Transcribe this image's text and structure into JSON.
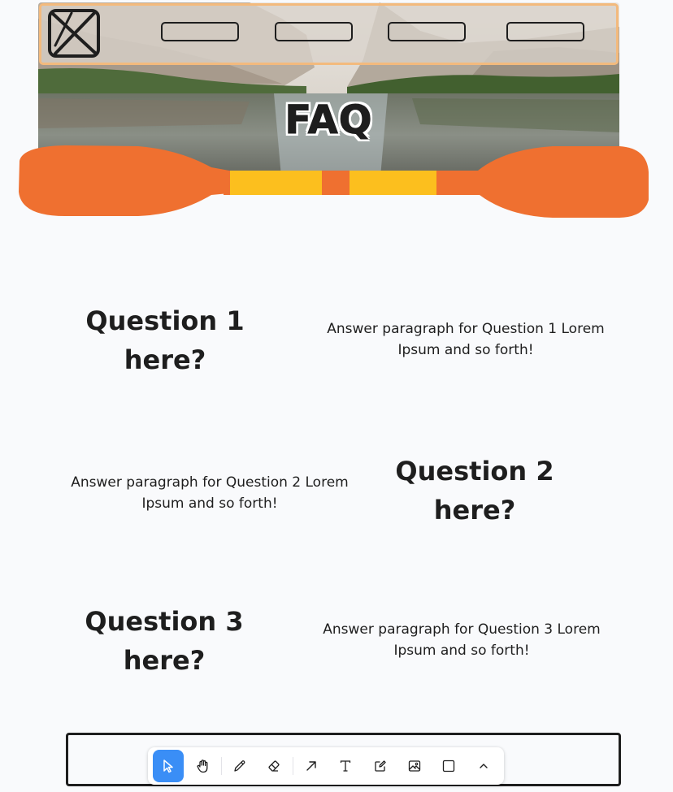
{
  "header": {
    "title": "FAQ",
    "nav_buttons": [
      "",
      "",
      "",
      ""
    ]
  },
  "faq": [
    {
      "question": "Question 1 here?",
      "answer": "Answer paragraph for Question 1 Lorem Ipsum and so forth!"
    },
    {
      "question": "Question 2 here?",
      "answer": "Answer paragraph for Question 2 Lorem Ipsum and so forth!"
    },
    {
      "question": "Question 3 here?",
      "answer": "Answer paragraph for Question 3 Lorem Ipsum and so forth!"
    }
  ],
  "toolbar": {
    "tools": [
      {
        "name": "selection",
        "icon": "pointer-icon",
        "active": true
      },
      {
        "name": "hand",
        "icon": "hand-icon",
        "active": false
      },
      {
        "name": "draw",
        "icon": "pencil-icon",
        "active": false
      },
      {
        "name": "eraser",
        "icon": "eraser-icon",
        "active": false
      },
      {
        "name": "arrow",
        "icon": "arrow-icon",
        "active": false
      },
      {
        "name": "text",
        "icon": "text-icon",
        "active": false
      },
      {
        "name": "note",
        "icon": "note-icon",
        "active": false
      },
      {
        "name": "asset",
        "icon": "image-icon",
        "active": false
      },
      {
        "name": "rectangle",
        "icon": "rectangle-icon",
        "active": false
      },
      {
        "name": "more",
        "icon": "chevron-up-icon",
        "active": false
      }
    ]
  },
  "colors": {
    "paddle_orange": "#ef7030",
    "paddle_yellow": "#fcbf1e",
    "nav_border": "#f3ba7d",
    "tool_active": "#3a8ef6",
    "ink": "#1e1e1e"
  }
}
